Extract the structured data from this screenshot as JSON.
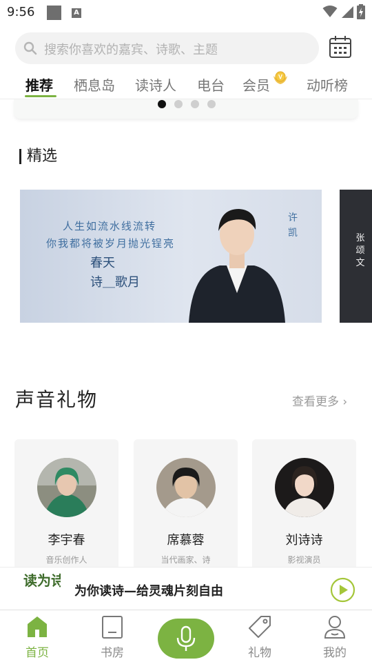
{
  "status_bar": {
    "time": "9:56",
    "a_badge": "A"
  },
  "search": {
    "placeholder": "搜索你喜欢的嘉宾、诗歌、主题"
  },
  "tabs": [
    {
      "label": "推荐",
      "active": true
    },
    {
      "label": "栖息岛"
    },
    {
      "label": "读诗人"
    },
    {
      "label": "电台"
    },
    {
      "label": "会员"
    },
    {
      "label": "动听榜"
    }
  ],
  "banner": {
    "dots": 4,
    "active_dot": 0
  },
  "featured": {
    "title": "精选",
    "cards": [
      {
        "poem_line_1": "人生如流水线流转",
        "poem_line_2": "你我都将被岁月抛光锃亮",
        "sub_1": "春天",
        "sub_2": "诗＿歌月",
        "name": "许凯"
      },
      {
        "name": "张颂文"
      }
    ]
  },
  "gifts": {
    "title": "声音礼物",
    "more": "查看更多",
    "items": [
      {
        "name": "李宇春",
        "role": "音乐创作人"
      },
      {
        "name": "席慕蓉",
        "role": "当代画家、诗"
      },
      {
        "name": "刘诗诗",
        "role": "影视演员"
      }
    ]
  },
  "player": {
    "logo_text": "读为诗你",
    "title": "为你读诗—给灵魂片刻自由"
  },
  "nav": {
    "home": "首页",
    "library": "书房",
    "gifts": "礼物",
    "mine": "我的"
  },
  "colors": {
    "accent": "#7cb342",
    "text": "#222222",
    "muted": "#8a8a8a"
  }
}
